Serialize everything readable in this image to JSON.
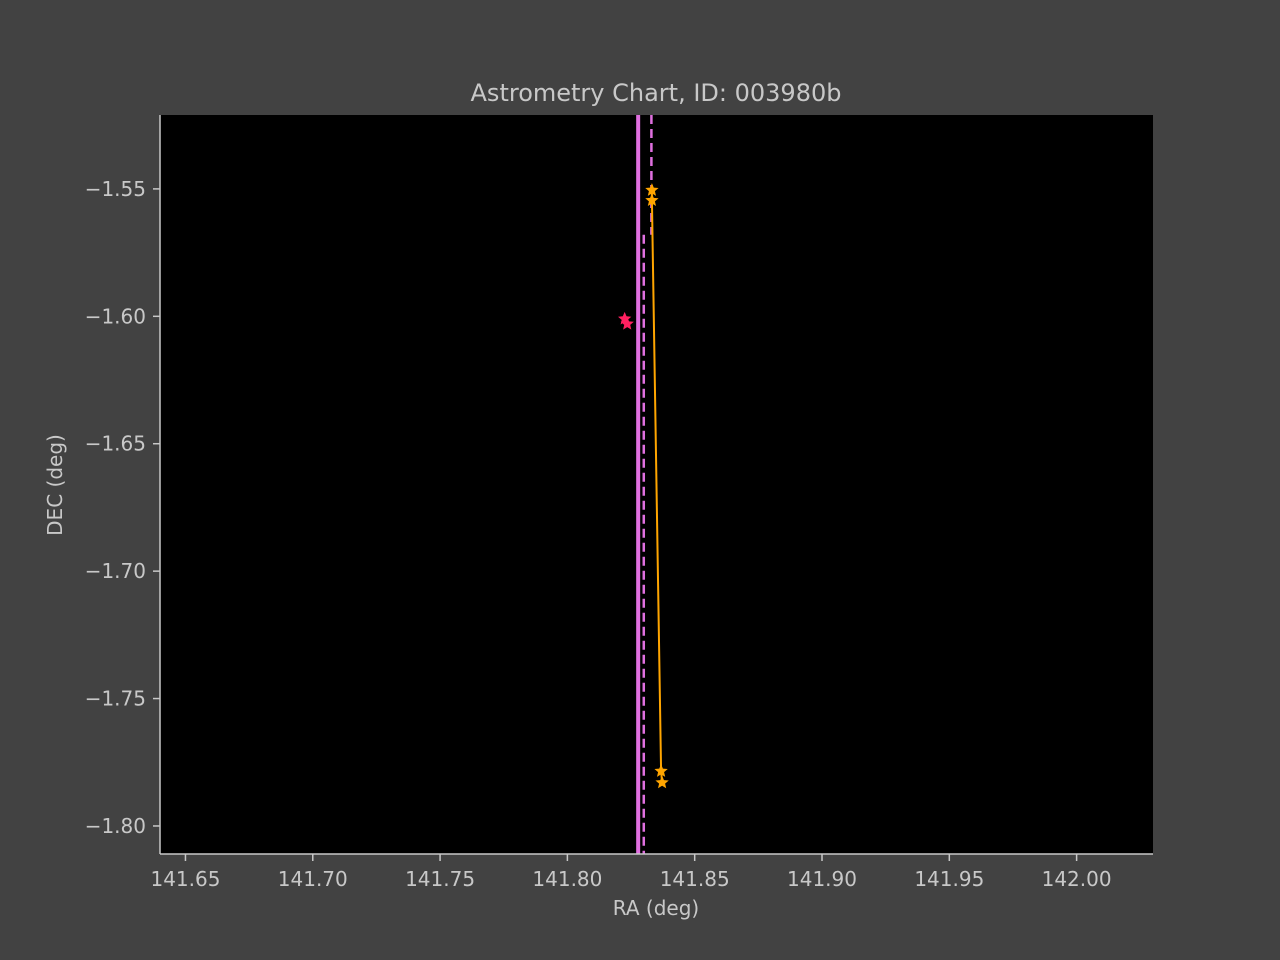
{
  "colors": {
    "figure_background": "#424242",
    "plot_background": "#000000",
    "axis_text": "#c8c8c8",
    "trajectory": "#ffa500",
    "reference_star": "#ff2060",
    "vertical_line": "#e070e0"
  },
  "chart_data": {
    "type": "line",
    "title": "Astrometry Chart, ID: 003980b",
    "xlabel": "RA (deg)",
    "ylabel": "DEC (deg)",
    "xlim": [
      141.64,
      142.03
    ],
    "ylim": [
      -1.811,
      -1.521
    ],
    "xticks": [
      141.65,
      141.7,
      141.75,
      141.8,
      141.85,
      141.9,
      141.95,
      142.0
    ],
    "xtick_labels": [
      "141.65",
      "141.70",
      "141.75",
      "141.80",
      "141.85",
      "141.90",
      "141.95",
      "142.00"
    ],
    "yticks": [
      -1.55,
      -1.6,
      -1.65,
      -1.7,
      -1.75,
      -1.8
    ],
    "ytick_labels": [
      "−1.55",
      "−1.60",
      "−1.65",
      "−1.70",
      "−1.75",
      "−1.80"
    ],
    "grid": false,
    "series": [
      {
        "marker": "star",
        "style": "solid",
        "color": "#ffa500",
        "x": [
          141.8332,
          141.8332,
          141.8368,
          141.8372
        ],
        "y": [
          -1.5505,
          -1.5545,
          -1.7785,
          -1.783
        ]
      },
      {
        "marker": "star",
        "style": "none",
        "color": "#ff2060",
        "x": [
          141.8225,
          141.8235
        ],
        "y": [
          -1.601,
          -1.603
        ]
      }
    ],
    "vlines": [
      {
        "x": 141.8278,
        "style": "solid",
        "color": "#e070e0"
      },
      {
        "x": 141.83,
        "style": "dashed",
        "color": "#e070e0",
        "y_range": [
          -1.811,
          -1.568
        ]
      },
      {
        "x": 141.833,
        "style": "dashed",
        "color": "#e070e0",
        "y_range": [
          -1.568,
          -1.521
        ]
      }
    ]
  }
}
